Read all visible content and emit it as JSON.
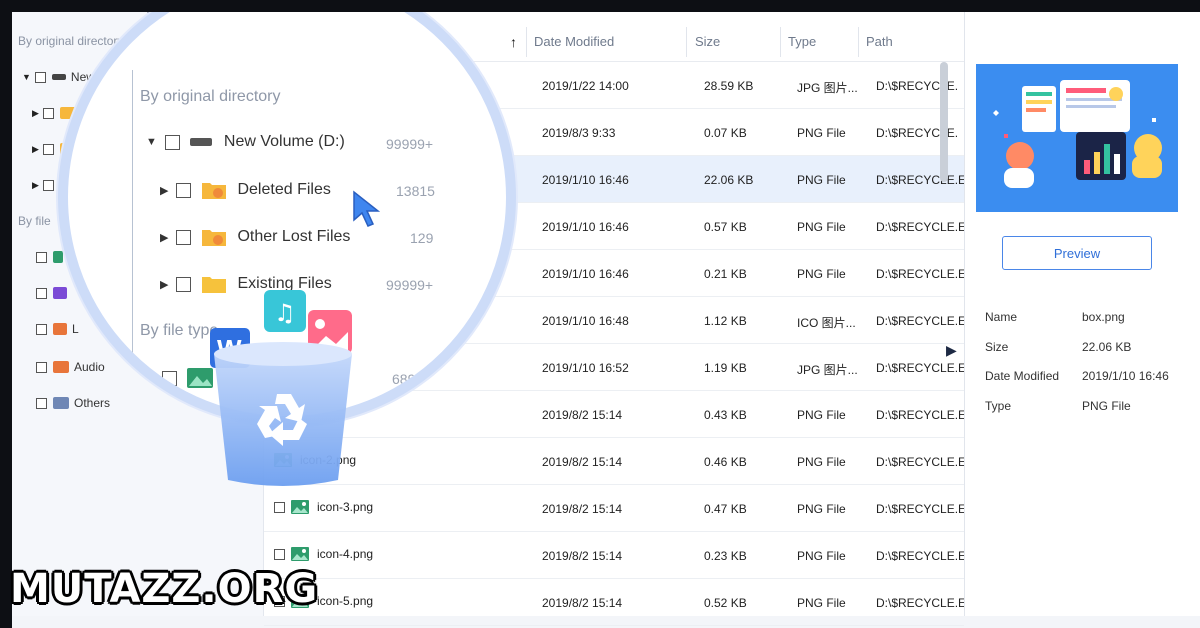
{
  "sidebar": {
    "section_original": "By original directory",
    "volume_label": "New",
    "section_file": "By file",
    "file_types": [
      "L",
      "Audio",
      "Others"
    ]
  },
  "magnifier": {
    "section_original": "By original directory",
    "volume": {
      "label": "New Volume (D:)",
      "count": "99999+"
    },
    "folders": [
      {
        "label": "Deleted Files",
        "count": "13815"
      },
      {
        "label": "Other Lost Files",
        "count": "129"
      },
      {
        "label": "Existing Files",
        "count": "99999+"
      }
    ],
    "section_type": "By file type",
    "type_count": "68974"
  },
  "table": {
    "sort_arrow": "↑",
    "columns": [
      "Date Modified",
      "Size",
      "Type",
      "Path"
    ],
    "rows": [
      {
        "name": "",
        "date": "2019/1/22 14:00",
        "size": "28.59 KB",
        "type": "JPG 图片...",
        "path": "D:\\$RECYCLE."
      },
      {
        "name": "",
        "date": "2019/8/3 9:33",
        "size": "0.07 KB",
        "type": "PNG File",
        "path": "D:\\$RECYCLE."
      },
      {
        "name": "",
        "date": "2019/1/10 16:46",
        "size": "22.06 KB",
        "type": "PNG File",
        "path": "D:\\$RECYCLE.E"
      },
      {
        "name": "",
        "date": "2019/1/10 16:46",
        "size": "0.57 KB",
        "type": "PNG File",
        "path": "D:\\$RECYCLE.E"
      },
      {
        "name": "",
        "date": "2019/1/10 16:46",
        "size": "0.21 KB",
        "type": "PNG File",
        "path": "D:\\$RECYCLE.E"
      },
      {
        "name": "",
        "date": "2019/1/10 16:48",
        "size": "1.12 KB",
        "type": "ICO 图片...",
        "path": "D:\\$RECYCLE.E"
      },
      {
        "name": "",
        "date": "2019/1/10 16:52",
        "size": "1.19 KB",
        "type": "JPG 图片...",
        "path": "D:\\$RECYCLE.E"
      },
      {
        "name": "n-1.png",
        "date": "2019/8/2 15:14",
        "size": "0.43 KB",
        "type": "PNG File",
        "path": "D:\\$RECYCLE.E"
      },
      {
        "name": "icon-2.png",
        "date": "2019/8/2 15:14",
        "size": "0.46 KB",
        "type": "PNG File",
        "path": "D:\\$RECYCLE.E"
      },
      {
        "name": "icon-3.png",
        "date": "2019/8/2 15:14",
        "size": "0.47 KB",
        "type": "PNG File",
        "path": "D:\\$RECYCLE.E"
      },
      {
        "name": "icon-4.png",
        "date": "2019/8/2 15:14",
        "size": "0.23 KB",
        "type": "PNG File",
        "path": "D:\\$RECYCLE.E"
      },
      {
        "name": "icon-5.png",
        "date": "2019/8/2 15:14",
        "size": "0.52 KB",
        "type": "PNG File",
        "path": "D:\\$RECYCLE.E"
      }
    ]
  },
  "preview": {
    "button_label": "Preview",
    "info": [
      {
        "label": "Name",
        "value": "box.png"
      },
      {
        "label": "Size",
        "value": "22.06 KB"
      },
      {
        "label": "Date Modified",
        "value": "2019/1/10 16:46"
      },
      {
        "label": "Type",
        "value": "PNG File"
      }
    ]
  },
  "watermark": "MUTAZZ.ORG",
  "colors": {
    "accent": "#4a86e8",
    "selected_row": "#e8f0fc",
    "preview_bg": "#3b8df0",
    "nav_dark": "#1b2447",
    "folder": "#f6b73c"
  }
}
